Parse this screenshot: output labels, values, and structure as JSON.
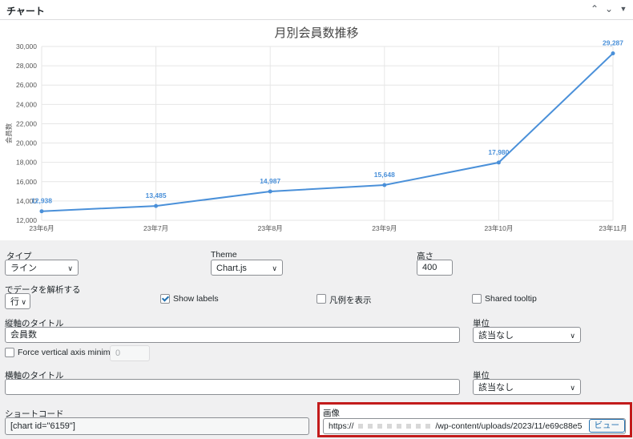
{
  "panel": {
    "title": "チャート",
    "up_icon": "chevron-up-icon",
    "down_icon": "chevron-down-icon",
    "toggle_icon": "caret-down-icon"
  },
  "chart_data": {
    "type": "line",
    "title": "月別会員数推移",
    "ylabel": "会員数",
    "xlabel": "",
    "categories": [
      "23年6月",
      "23年7月",
      "23年8月",
      "23年9月",
      "23年10月",
      "23年11月"
    ],
    "series": [
      {
        "values": [
          12938,
          13485,
          14987,
          15648,
          17980,
          29287
        ]
      }
    ],
    "value_labels": [
      "12,938",
      "13,485",
      "14,987",
      "15,648",
      "17,980",
      "29,287"
    ],
    "y_ticks": [
      "30,000",
      "28,000",
      "26,000",
      "24,000",
      "22,000",
      "20,000",
      "18,000",
      "16,000",
      "14,000",
      "12,000"
    ],
    "ylim": [
      12000,
      30000
    ],
    "grid": true,
    "color": "#4a90d9"
  },
  "form": {
    "type_label": "タイプ",
    "type_value": "ライン",
    "theme_label": "Theme",
    "theme_value": "Chart.js",
    "height_label": "高さ",
    "height_value": "400",
    "parse_label": "でデータを解析する",
    "parse_value": "行",
    "show_labels": "Show labels",
    "show_labels_checked": true,
    "legend_label": "凡例を表示",
    "legend_checked": false,
    "shared_tooltip": "Shared tooltip",
    "shared_tooltip_checked": false,
    "vaxis_title_label": "縦軸のタイトル",
    "vaxis_title_value": "会員数",
    "vunit_label": "単位",
    "vunit_value": "該当なし",
    "force_min_label": "Force vertical axis minimum:",
    "force_min_value": "0",
    "haxis_title_label": "横軸のタイトル",
    "haxis_title_value": "",
    "hunit_label": "単位",
    "hunit_value": "該当なし",
    "shortcode_label": "ショートコード",
    "shortcode_value": "[chart id=\"6159\"]",
    "image_label": "画像",
    "image_url_prefix": "https://",
    "image_url_suffix": "/wp-content/uploads/2023/11/e69c88e5",
    "image_button": "ビュー"
  }
}
